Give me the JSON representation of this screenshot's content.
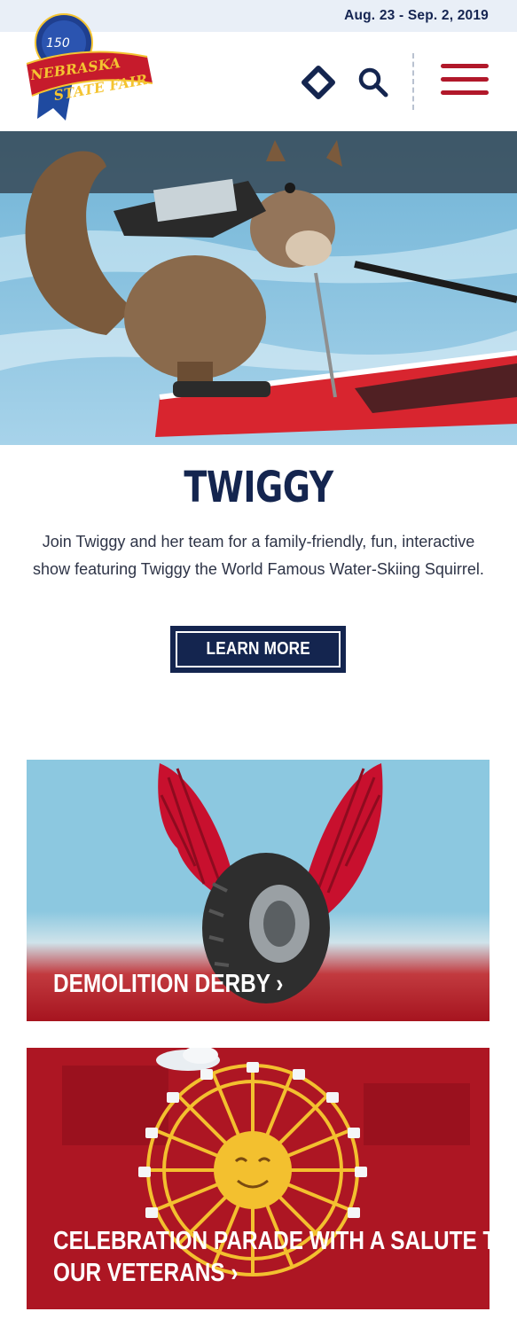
{
  "topbar": {
    "dates": "Aug. 23 - Sep. 2, 2019"
  },
  "logo": {
    "anniversary": "150",
    "line1": "NEBRASKA",
    "line2": "STATE FAIR"
  },
  "header": {
    "ticket_icon": "ticket-icon",
    "search_icon": "search-icon",
    "menu_icon": "hamburger-menu-icon"
  },
  "slider": {
    "slide_count": 4,
    "active_slide": 4
  },
  "feature": {
    "title": "TWIGGY",
    "description": "Join Twiggy and her team for a family-friendly, fun, interactive show featuring Twiggy the World Famous Water-Skiing Squirrel.",
    "button_label": "LEARN MORE"
  },
  "cards": [
    {
      "label": "DEMOLITION DERBY ›"
    },
    {
      "label_line1": "CELEBRATION PARADE WITH A SALUTE TO",
      "label_line2": "OUR VETERANS ›"
    }
  ],
  "colors": {
    "navy": "#14254f",
    "red": "#b1182a",
    "sky": "#8cc8e0",
    "topbar": "#e9eff7"
  }
}
